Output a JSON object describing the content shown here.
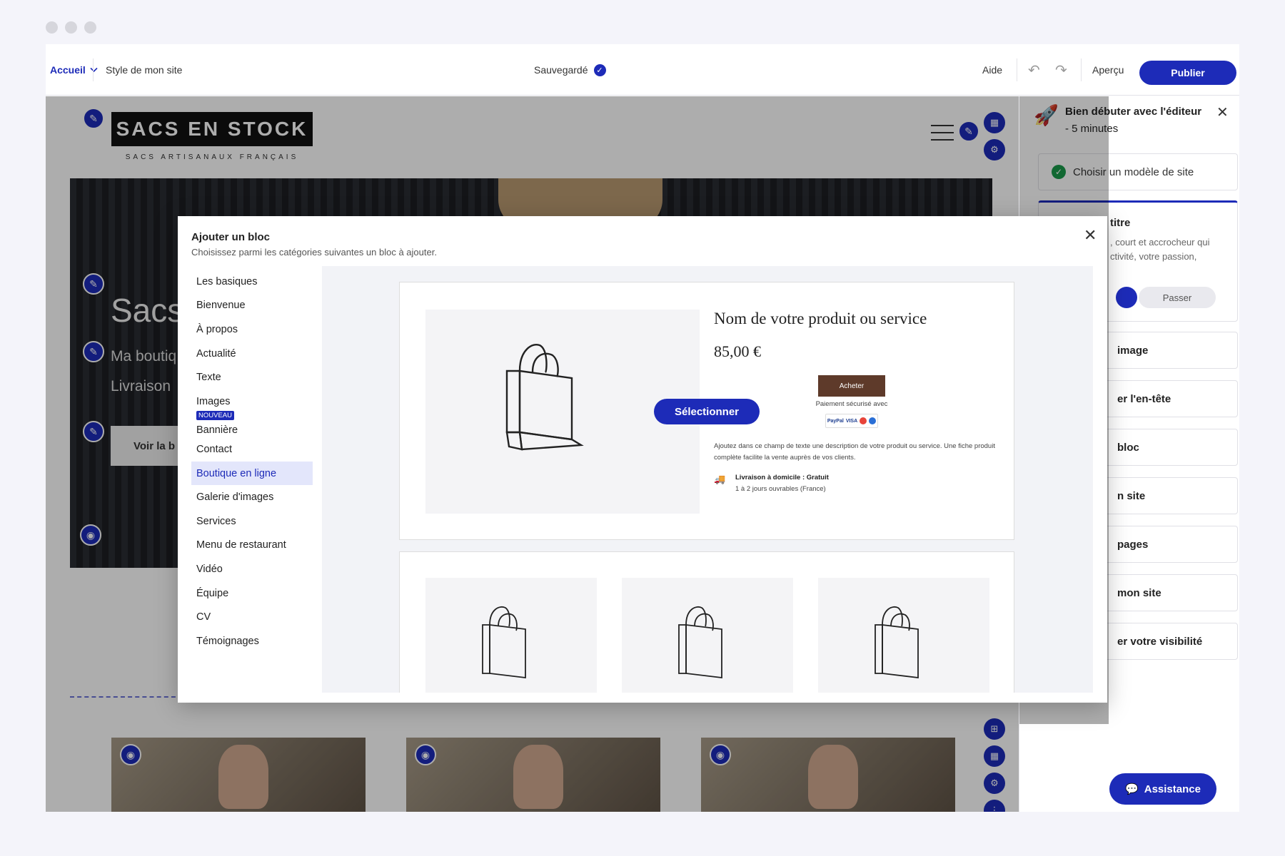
{
  "window": {
    "controls": [
      "close",
      "minimize",
      "maximize"
    ]
  },
  "topbar": {
    "home_label": "Accueil",
    "style_label": "Style de mon site",
    "saved_label": "Sauvegardé",
    "help_label": "Aide",
    "preview_label": "Aperçu",
    "publish_label": "Publier"
  },
  "site": {
    "logo_title": "SACS EN STOCK",
    "logo_subtitle": "SACS ARTISANAUX FRANÇAIS",
    "hero_title": "Sacs",
    "hero_line1": "Ma boutiq",
    "hero_line2": "Livraison",
    "hero_button": "Voir la b"
  },
  "right_panel": {
    "title_bold": "Bien débuter avec l'éditeur",
    "title_thin": " - 5 minutes",
    "done_step": "Choisir un modèle de site",
    "expanded_title": "titre",
    "expanded_text": ", court et accrocheur qui ctivité, votre passion,",
    "skip_label": "Passer",
    "steps": [
      "image",
      "er l'en-tête",
      "bloc",
      "n site",
      "pages",
      "mon site",
      "er votre visibilité"
    ],
    "assistance_label": "Assistance"
  },
  "modal": {
    "title": "Ajouter un bloc",
    "subtitle": "Choisissez parmi les catégories suivantes un bloc à ajouter.",
    "categories": [
      {
        "label": "Les basiques"
      },
      {
        "label": "Bienvenue"
      },
      {
        "label": "À propos"
      },
      {
        "label": "Actualité"
      },
      {
        "label": "Texte"
      },
      {
        "label": "Images"
      },
      {
        "label": "Bannière",
        "badge": "NOUVEAU"
      },
      {
        "label": "Contact"
      },
      {
        "label": "Boutique en ligne",
        "active": true
      },
      {
        "label": "Galerie d'images"
      },
      {
        "label": "Services"
      },
      {
        "label": "Menu de restaurant"
      },
      {
        "label": "Vidéo"
      },
      {
        "label": "Équipe"
      },
      {
        "label": "CV"
      },
      {
        "label": "Témoignages"
      }
    ],
    "preview": {
      "product_name": "Nom de votre produit ou service",
      "price": "85,00 €",
      "select_label": "Sélectionner",
      "buy_label": "Acheter",
      "secure_label": "Paiement sécurisé avec",
      "paypal_label": "PayPal",
      "visa_label": "VISA",
      "description": "Ajoutez dans ce champ de texte une description de votre produit ou service. Une fiche produit complète facilite la vente auprès de vos clients.",
      "shipping_title": "Livraison à domicile : Gratuit",
      "shipping_sub": "1 à 2 jours ouvrables (France)"
    }
  },
  "colors": {
    "accent": "#1d2bb8",
    "buy": "#5e3a2a",
    "success": "#1a9a4a",
    "active_bg": "#e3e6fb"
  }
}
